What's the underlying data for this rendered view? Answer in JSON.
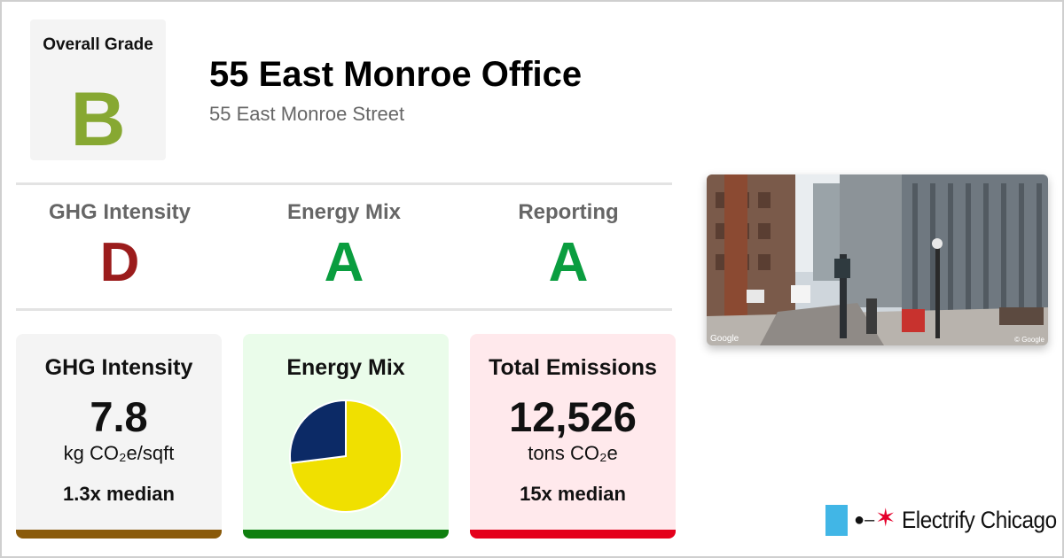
{
  "overall": {
    "label": "Overall Grade",
    "grade": "B",
    "grade_color": "#87a832"
  },
  "building": {
    "name": "55 East Monroe Office",
    "address": "55 East Monroe Street"
  },
  "grades": [
    {
      "label": "GHG Intensity",
      "grade": "D",
      "color": "#9b1c1c"
    },
    {
      "label": "Energy Mix",
      "grade": "A",
      "color": "#0a9d3f"
    },
    {
      "label": "Reporting",
      "grade": "A",
      "color": "#0a9d3f"
    }
  ],
  "cards": {
    "ghg": {
      "title": "GHG Intensity",
      "value": "7.8",
      "unit": "kg CO₂e/sqft",
      "median": "1.3x median",
      "bg": "#f4f4f4",
      "bar": "#8a5a0a"
    },
    "mix": {
      "title": "Energy Mix",
      "bg": "#eafcea",
      "bar": "#0f7f0f"
    },
    "emissions": {
      "title": "Total Emissions",
      "value": "12,526",
      "unit": "tons CO₂e",
      "median": "15x median",
      "bg": "#ffe9ec",
      "bar": "#e4001b"
    }
  },
  "chart_data": {
    "type": "pie",
    "title": "",
    "slices": [
      {
        "name": "",
        "value": 73,
        "color": "#f0e000"
      },
      {
        "name": "",
        "value": 27,
        "color": "#0c2a66"
      }
    ],
    "legend": "none"
  },
  "photo": {
    "credit": "Google",
    "copyright": "© Google"
  },
  "brand": {
    "name": "Electrify Chicago",
    "flag_color": "#41b6e6",
    "star_color": "#e4002b",
    "icons": [
      "plug-icon",
      "star-icon"
    ]
  }
}
